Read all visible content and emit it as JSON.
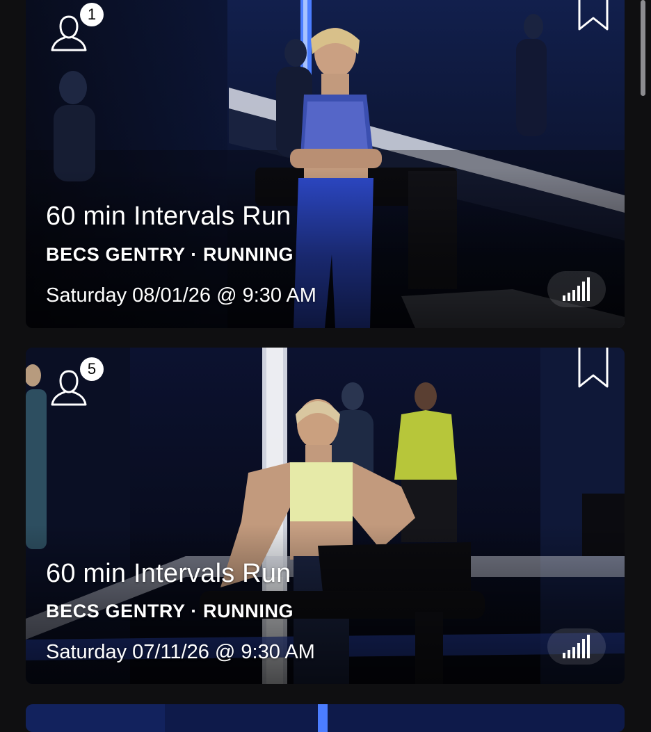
{
  "classes": [
    {
      "title": "60 min Intervals Run",
      "instructor": "BECS GENTRY",
      "discipline": "RUNNING",
      "separator": "·",
      "date": "Saturday 08/01/26 @ 9:30 AM",
      "participants": "1",
      "icons": {
        "participants": "user-icon",
        "bookmark": "bookmark-icon",
        "difficulty": "difficulty-bars-icon"
      }
    },
    {
      "title": "60 min Intervals Run",
      "instructor": "BECS GENTRY",
      "discipline": "RUNNING",
      "separator": "·",
      "date": "Saturday 07/11/26 @ 9:30 AM",
      "participants": "5",
      "icons": {
        "participants": "user-icon",
        "bookmark": "bookmark-icon",
        "difficulty": "difficulty-bars-icon"
      }
    }
  ],
  "colors": {
    "background": "#0f0f11",
    "card_blue": "#0e1636",
    "accent_light": "#dfe6ff",
    "text": "#ffffff"
  }
}
